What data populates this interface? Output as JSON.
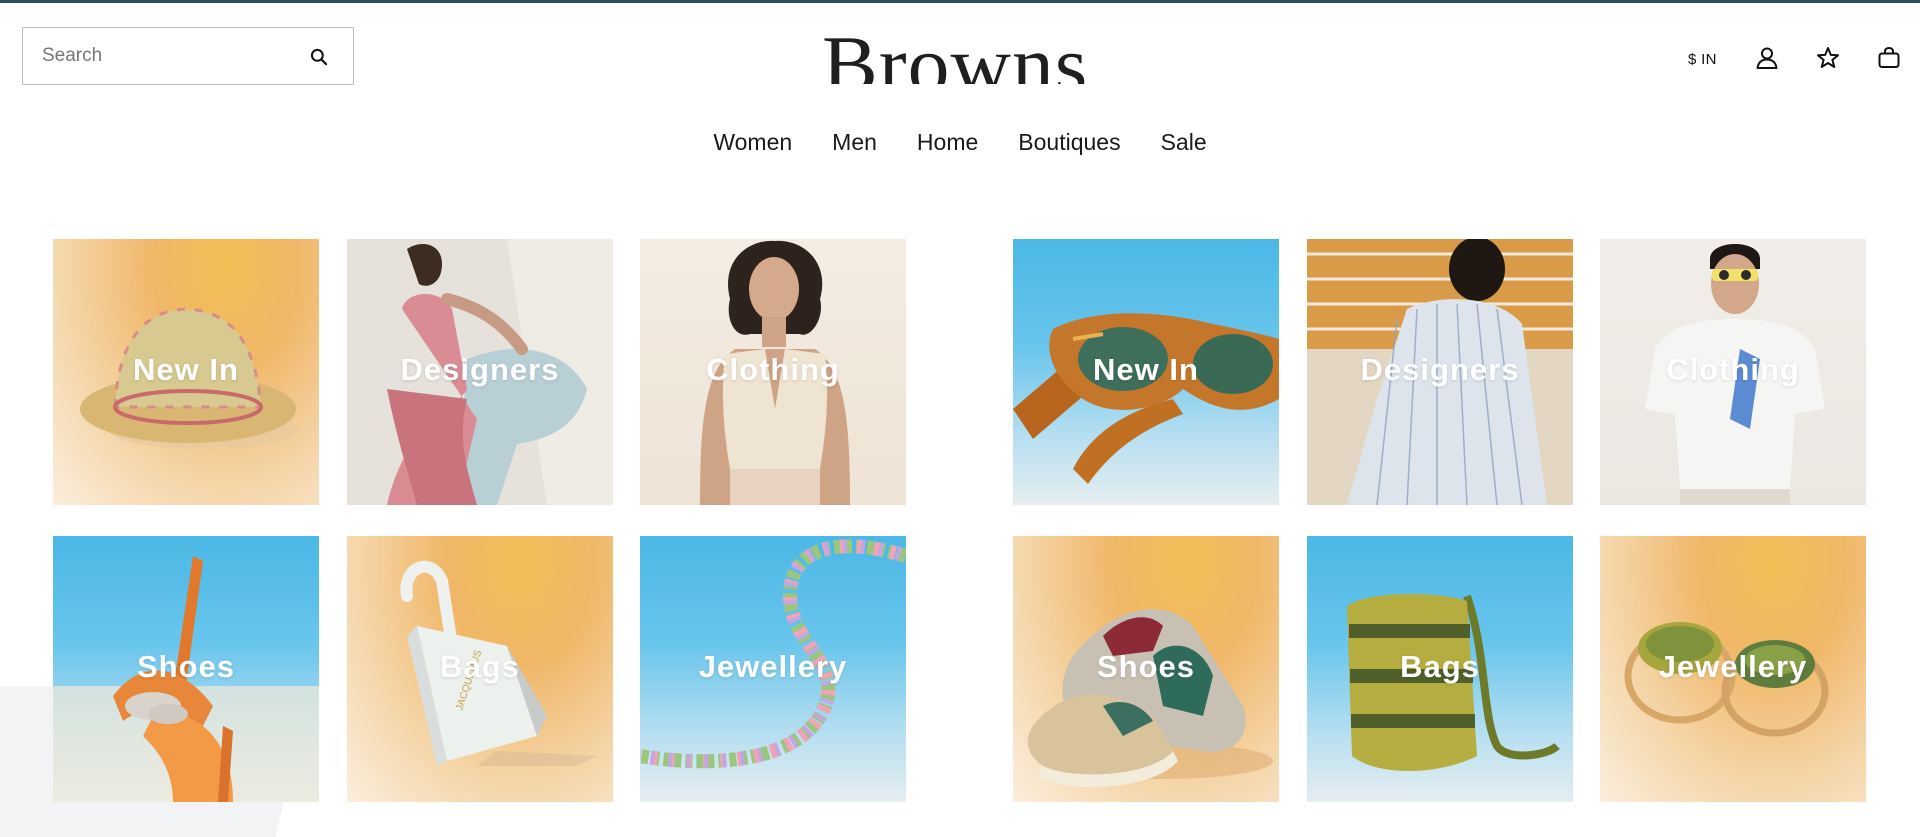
{
  "header": {
    "search_placeholder": "Search",
    "logo_text": "Browns",
    "currency_label": "$ IN",
    "icons": [
      "search-icon",
      "account-icon",
      "wishlist-star-icon",
      "shopping-bag-icon"
    ]
  },
  "nav": {
    "items": [
      {
        "label": "Women"
      },
      {
        "label": "Men"
      },
      {
        "label": "Home"
      },
      {
        "label": "Boutiques"
      },
      {
        "label": "Sale"
      }
    ]
  },
  "women_grid": {
    "tiles": [
      {
        "label": "New In",
        "image": "bucket-hat"
      },
      {
        "label": "Designers",
        "image": "pink-dress-model"
      },
      {
        "label": "Clothing",
        "image": "cream-top-model"
      },
      {
        "label": "Shoes",
        "image": "orange-heels"
      },
      {
        "label": "Bags",
        "image": "white-handbag"
      },
      {
        "label": "Jewellery",
        "image": "bead-necklace"
      }
    ]
  },
  "men_grid": {
    "tiles": [
      {
        "label": "New In",
        "image": "tortoiseshell-sunglasses"
      },
      {
        "label": "Designers",
        "image": "striped-shirt-model"
      },
      {
        "label": "Clothing",
        "image": "white-tshirt-model"
      },
      {
        "label": "Shoes",
        "image": "sneakers"
      },
      {
        "label": "Bags",
        "image": "knit-bag"
      },
      {
        "label": "Jewellery",
        "image": "gold-rings"
      }
    ]
  },
  "colors": {
    "accent_rule": "#2f4f5a",
    "text": "#1a1a1a",
    "tile_label": "#ffffff"
  }
}
